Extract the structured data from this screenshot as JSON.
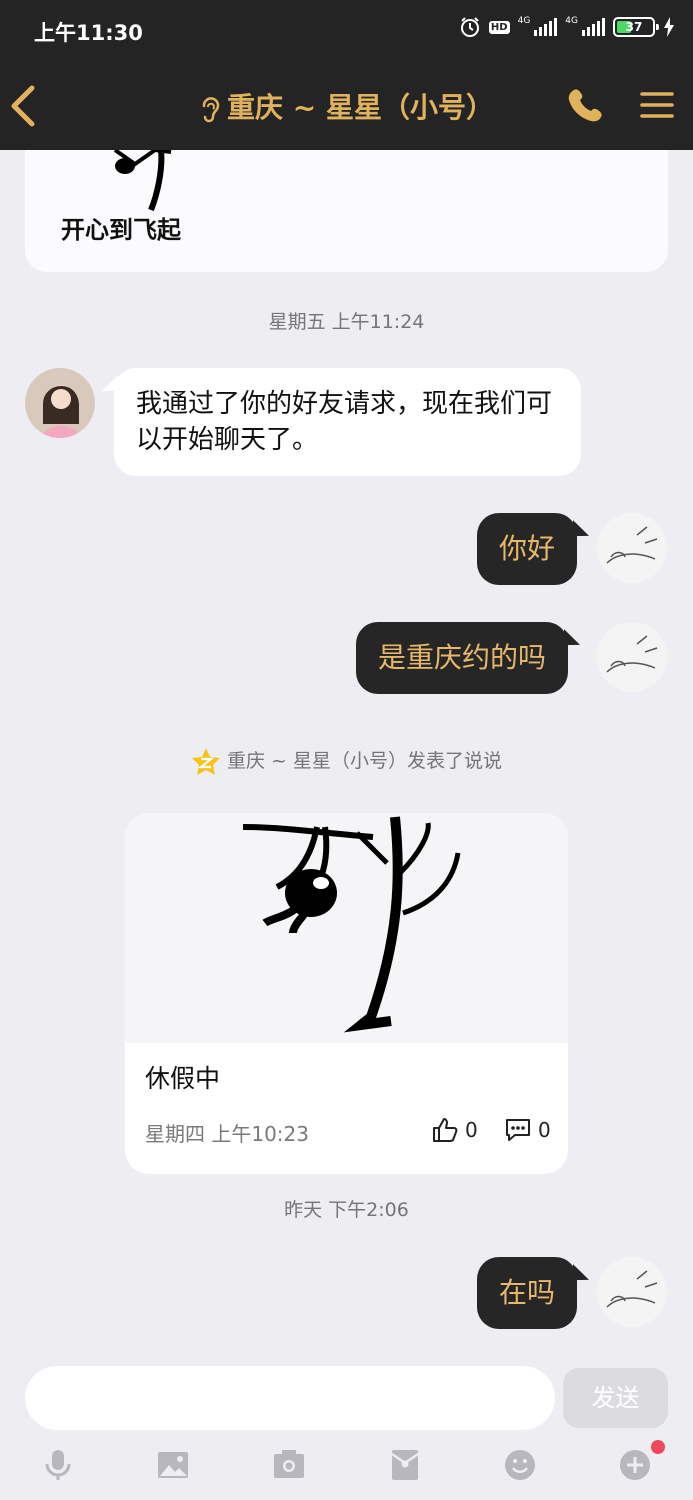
{
  "status_bar": {
    "time": "上午11:30",
    "hd": "HD",
    "network_1": "4G",
    "network_2": "4G",
    "battery": "37"
  },
  "header": {
    "title": "重庆 ~ 星星（小号）",
    "icons": [
      "back-arrow-icon",
      "ear-icon",
      "phone-icon",
      "menu-icon"
    ],
    "accent_color": "#e0b25c"
  },
  "prev_message": {
    "caption": "开心到飞起"
  },
  "messages": [
    {
      "time": "星期五 上午11:24"
    },
    {
      "from": "contact",
      "text": "我通过了你的好友请求，现在我们可以开始聊天了。"
    },
    {
      "from": "self",
      "text": "你好"
    },
    {
      "from": "self",
      "text": "是重庆约的吗"
    }
  ],
  "feed": {
    "note": "重庆 ~ 星星（小号）发表了说说",
    "post_text": "休假中",
    "post_time": "星期四 上午10:23",
    "likes": "0",
    "comments": "0"
  },
  "later": [
    {
      "time": "昨天 下午2:06"
    },
    {
      "from": "self",
      "text": "在吗"
    }
  ],
  "input": {
    "value": "",
    "send_label": "发送"
  },
  "toolbar": {
    "icons": [
      "microphone-icon",
      "image-icon",
      "camera-icon",
      "red-envelope-icon",
      "emoji-icon",
      "plus-icon"
    ],
    "badge_color": "#f0485a"
  }
}
